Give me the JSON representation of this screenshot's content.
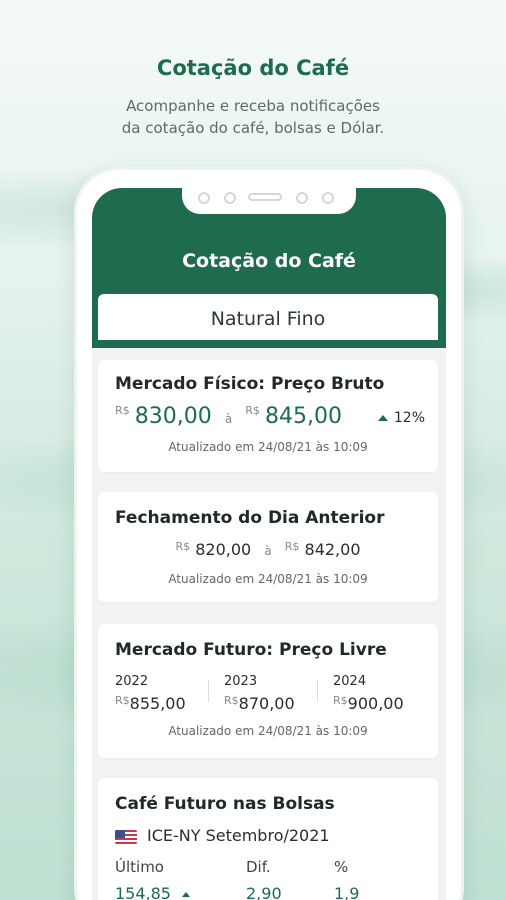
{
  "hero": {
    "title": "Cotação do Café",
    "subtitle_line1": "Acompanhe e receba notificações",
    "subtitle_line2": "da cotação do café, bolsas e Dólar."
  },
  "app": {
    "title": "Cotação do Café",
    "tab": "Natural Fino"
  },
  "colors": {
    "brand_green": "#1f6b4d"
  },
  "cards": {
    "fisico": {
      "title": "Mercado Físico: Preço Bruto",
      "currency": "R$",
      "min": "830,00",
      "sep": "à",
      "max": "845,00",
      "change": "12%",
      "change_icon": "up-arrow-icon",
      "updated": "Atualizado em 24/08/21 às 10:09"
    },
    "fechamento": {
      "title": "Fechamento do Dia Anterior",
      "currency": "R$",
      "min": "820,00",
      "sep": "à",
      "max": "842,00",
      "updated": "Atualizado em 24/08/21 às 10:09"
    },
    "futuro": {
      "title": "Mercado Futuro: Preço Livre",
      "currency": "R$",
      "years": [
        {
          "year": "2022",
          "value": "855,00"
        },
        {
          "year": "2023",
          "value": "870,00"
        },
        {
          "year": "2024",
          "value": "900,00"
        }
      ],
      "updated": "Atualizado em 24/08/21 às 10:09"
    },
    "bolsas": {
      "title": "Café Futuro nas Bolsas",
      "flag_icon": "us-flag-icon",
      "exchange": "ICE-NY Setembro/2021",
      "col_last": "Último",
      "col_diff": "Dif.",
      "col_pct": "%",
      "last": "154,85",
      "diff": "2,90",
      "pct": "1,9"
    }
  }
}
